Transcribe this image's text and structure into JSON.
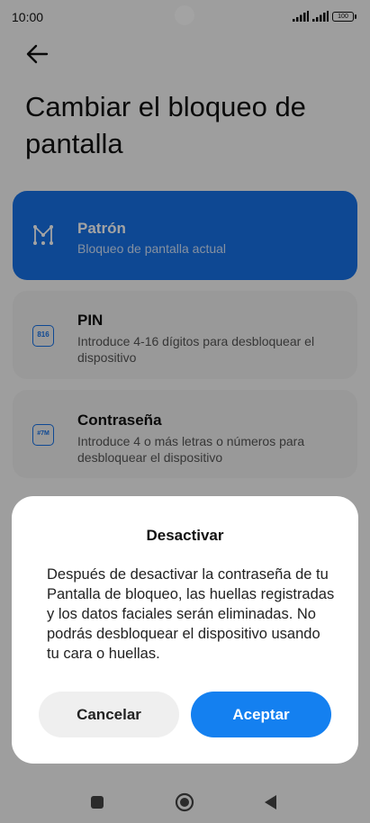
{
  "status_bar": {
    "time": "10:00",
    "battery": "100"
  },
  "page": {
    "title": "Cambiar el bloqueo de pantalla"
  },
  "options": [
    {
      "label": "Patrón",
      "description": "Bloqueo de pantalla actual",
      "icon": "pattern-icon",
      "selected": true
    },
    {
      "label": "PIN",
      "description": "Introduce 4-16 dígitos para desbloquear el dispositivo",
      "icon": "pin-icon",
      "icon_text": "816",
      "selected": false
    },
    {
      "label": "Contraseña",
      "description": "Introduce 4 o más letras o números para desbloquear el dispositivo",
      "icon": "password-icon",
      "icon_text": "#7M",
      "selected": false
    }
  ],
  "dialog": {
    "title": "Desactivar",
    "message": "Después de desactivar la contraseña de tu Pantalla de bloqueo, las huellas registradas y los datos faciales serán eliminadas. No podrás desbloquear el dispositivo usando tu cara o huellas.",
    "cancel_label": "Cancelar",
    "ok_label": "Aceptar"
  },
  "colors": {
    "accent": "#1671e6",
    "ok_button": "#1480f0"
  },
  "nav": [
    "recents-icon",
    "home-icon",
    "back-icon"
  ]
}
